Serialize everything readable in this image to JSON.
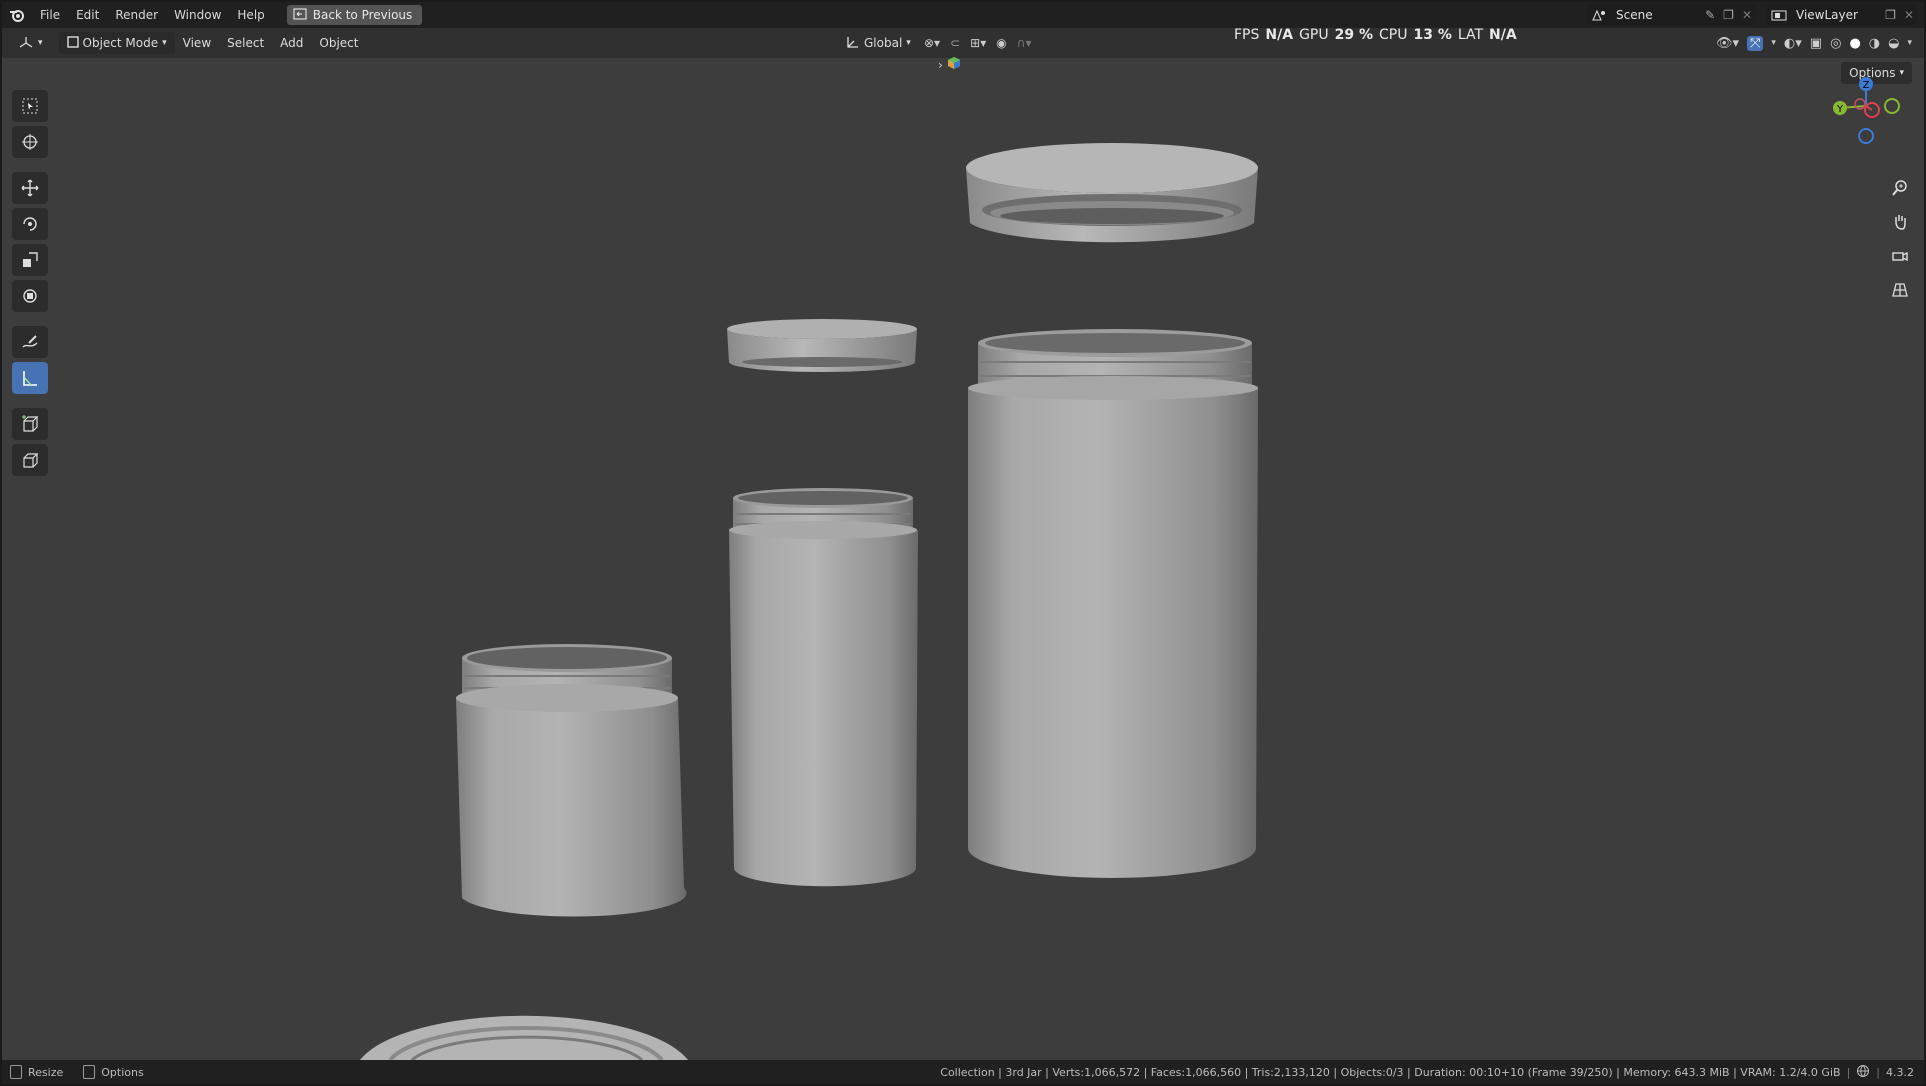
{
  "topbar": {
    "menus": [
      "File",
      "Edit",
      "Render",
      "Window",
      "Help"
    ],
    "back_button": "Back to Previous",
    "scene": "Scene",
    "view_layer": "ViewLayer"
  },
  "header": {
    "mode": "Object Mode",
    "menus": [
      "View",
      "Select",
      "Add",
      "Object"
    ],
    "orientation": "Global",
    "stats": {
      "fps_label": "FPS",
      "fps": "N/A",
      "gpu_label": "GPU",
      "gpu": "29 %",
      "cpu_label": "CPU",
      "cpu": "13 %",
      "lat_label": "LAT",
      "lat": "N/A"
    },
    "options": "Options"
  },
  "gizmo": {
    "z": "Z",
    "y": "Y",
    "x": "X"
  },
  "statusbar": {
    "resize": "Resize",
    "options": "Options",
    "info": "Collection | 3rd Jar | Verts:1,066,572 | Faces:1,066,560 | Tris:2,133,120 | Objects:0/3 | Duration: 00:10+10 (Frame 39/250) | Memory: 643.3 MiB | VRAM: 1.2/4.0 GiB",
    "version": "4.3.2"
  },
  "colors": {
    "accent": "#4772b3",
    "background": "#3d3d3d",
    "axis_x": "#e04050",
    "axis_y": "#8ab82e",
    "axis_z": "#3a7bd5"
  },
  "tools": [
    "select-box-icon",
    "cursor-icon",
    "move-icon",
    "rotate-icon",
    "scale-icon",
    "transform-icon",
    "annotate-icon",
    "measure-icon",
    "add-cube-icon",
    "extrude-icon"
  ]
}
